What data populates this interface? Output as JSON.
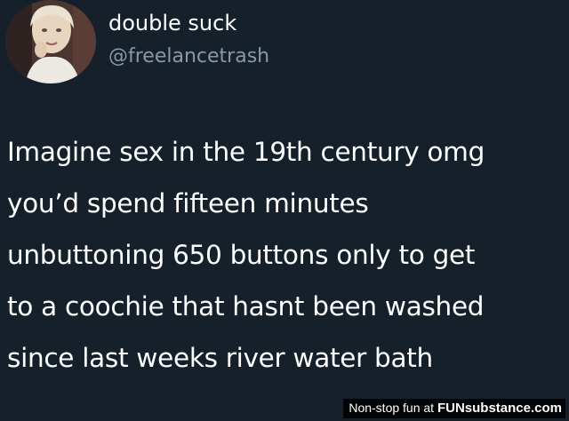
{
  "tweet": {
    "display_name": "double suck",
    "handle": "@freelancetrash",
    "avatar_icon": "profile-photo",
    "body_lines": [
      "Imagine sex in the 19th century omg",
      "you’d spend fifteen minutes",
      "unbuttoning 650 buttons only to get",
      "to a coochie that hasnt been washed",
      "since last weeks river water bath"
    ]
  },
  "watermark": {
    "prefix": "Non-stop fun at ",
    "brand": "FUNsubstance.com"
  },
  "colors": {
    "background": "#15202b",
    "text": "#ffffff",
    "handle": "#8899a6"
  }
}
